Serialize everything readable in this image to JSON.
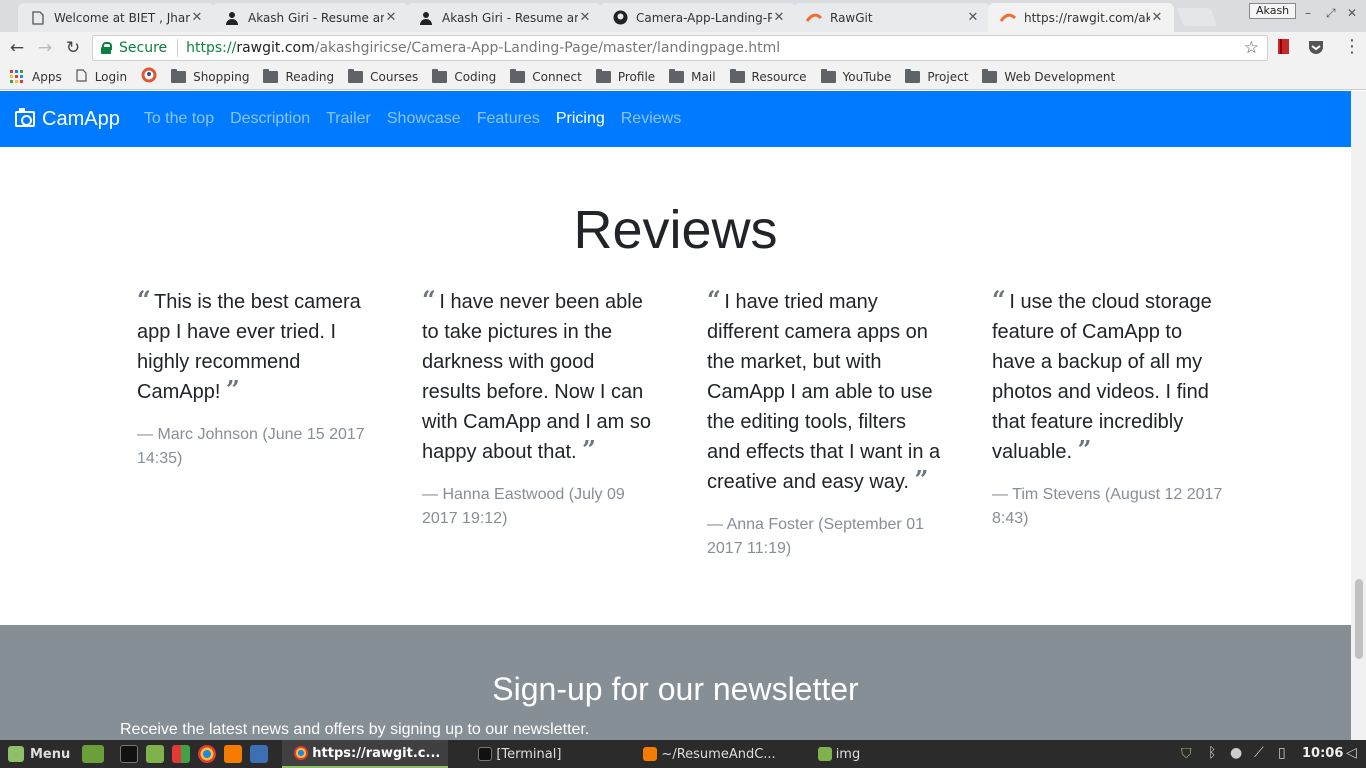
{
  "browser": {
    "tabs": [
      {
        "title": "Welcome at BIET , Jhansi",
        "icon": "document-icon"
      },
      {
        "title": "Akash Giri - Resume and",
        "icon": "person-icon"
      },
      {
        "title": "Akash Giri - Resume and",
        "icon": "person-icon"
      },
      {
        "title": "Camera-App-Landing-Page",
        "icon": "github-icon"
      },
      {
        "title": "RawGit",
        "icon": "rawgit-icon"
      },
      {
        "title": "https://rawgit.com/akashgiricse",
        "icon": "rawgit-icon"
      }
    ],
    "profile_name": "Akash",
    "secure_label": "Secure",
    "url_scheme": "https://",
    "url_host": "rawgit.com",
    "url_path": "/akashgiricse/Camera-App-Landing-Page/master/landingpage.html",
    "bookmarks": [
      {
        "label": "Apps",
        "icon": "apps-grid-icon"
      },
      {
        "label": "Login",
        "icon": "document-icon"
      },
      {
        "label": "",
        "icon": "duckduckgo-icon"
      },
      {
        "label": "Shopping",
        "icon": "folder-icon"
      },
      {
        "label": "Reading",
        "icon": "folder-icon"
      },
      {
        "label": "Courses",
        "icon": "folder-icon"
      },
      {
        "label": "Coding",
        "icon": "folder-icon"
      },
      {
        "label": "Connect",
        "icon": "folder-icon"
      },
      {
        "label": "Profile",
        "icon": "folder-icon"
      },
      {
        "label": "Mail",
        "icon": "folder-icon"
      },
      {
        "label": "Resource",
        "icon": "folder-icon"
      },
      {
        "label": "YouTube",
        "icon": "folder-icon"
      },
      {
        "label": "Project",
        "icon": "folder-icon"
      },
      {
        "label": "Web Development",
        "icon": "folder-icon"
      }
    ]
  },
  "site": {
    "brand": "CamApp",
    "nav": [
      "To the top",
      "Description",
      "Trailer",
      "Showcase",
      "Features",
      "Pricing",
      "Reviews"
    ],
    "active_nav": "Pricing",
    "colors": {
      "navbar": "#007bff",
      "newsletter_bg": "#868e96",
      "author": "#868e96"
    },
    "reviews_title": "Reviews",
    "reviews": [
      {
        "text": "This is the best camera app I have ever tried. I highly recommend CamApp!",
        "author": "— Marc Johnson (June 15 2017 14:35)"
      },
      {
        "text": "I have never been able to take pictures in the darkness with good results before. Now I can with CamApp and I am so happy about that.",
        "author": "— Hanna Eastwood (July 09 2017 19:12)"
      },
      {
        "text": "I have tried many different camera apps on the market, but with CamApp I am able to use the editing tools, filters and effects that I want in a creative and easy way.",
        "author": "— Anna Foster (September 01 2017 11:19)"
      },
      {
        "text": "I use the cloud storage feature of CamApp to have a backup of all my photos and videos. I find that feature incredibly valuable.",
        "author": "— Tim Stevens (August 12 2017 8:43)"
      }
    ],
    "newsletter_title": "Sign-up for our newsletter",
    "newsletter_sub": "Receive the latest news and offers by signing up to our newsletter."
  },
  "taskbar": {
    "menu_label": "Menu",
    "windows": [
      {
        "label": "https://rawgit.c...",
        "icon": "chrome-icon",
        "active": true
      },
      {
        "label": "[Terminal]",
        "icon": "terminal-icon",
        "active": false
      },
      {
        "label": "~/ResumeAndC...",
        "icon": "sublime-icon",
        "active": false
      },
      {
        "label": "img",
        "icon": "folder-icon",
        "active": false
      }
    ],
    "clock": "10:06"
  }
}
